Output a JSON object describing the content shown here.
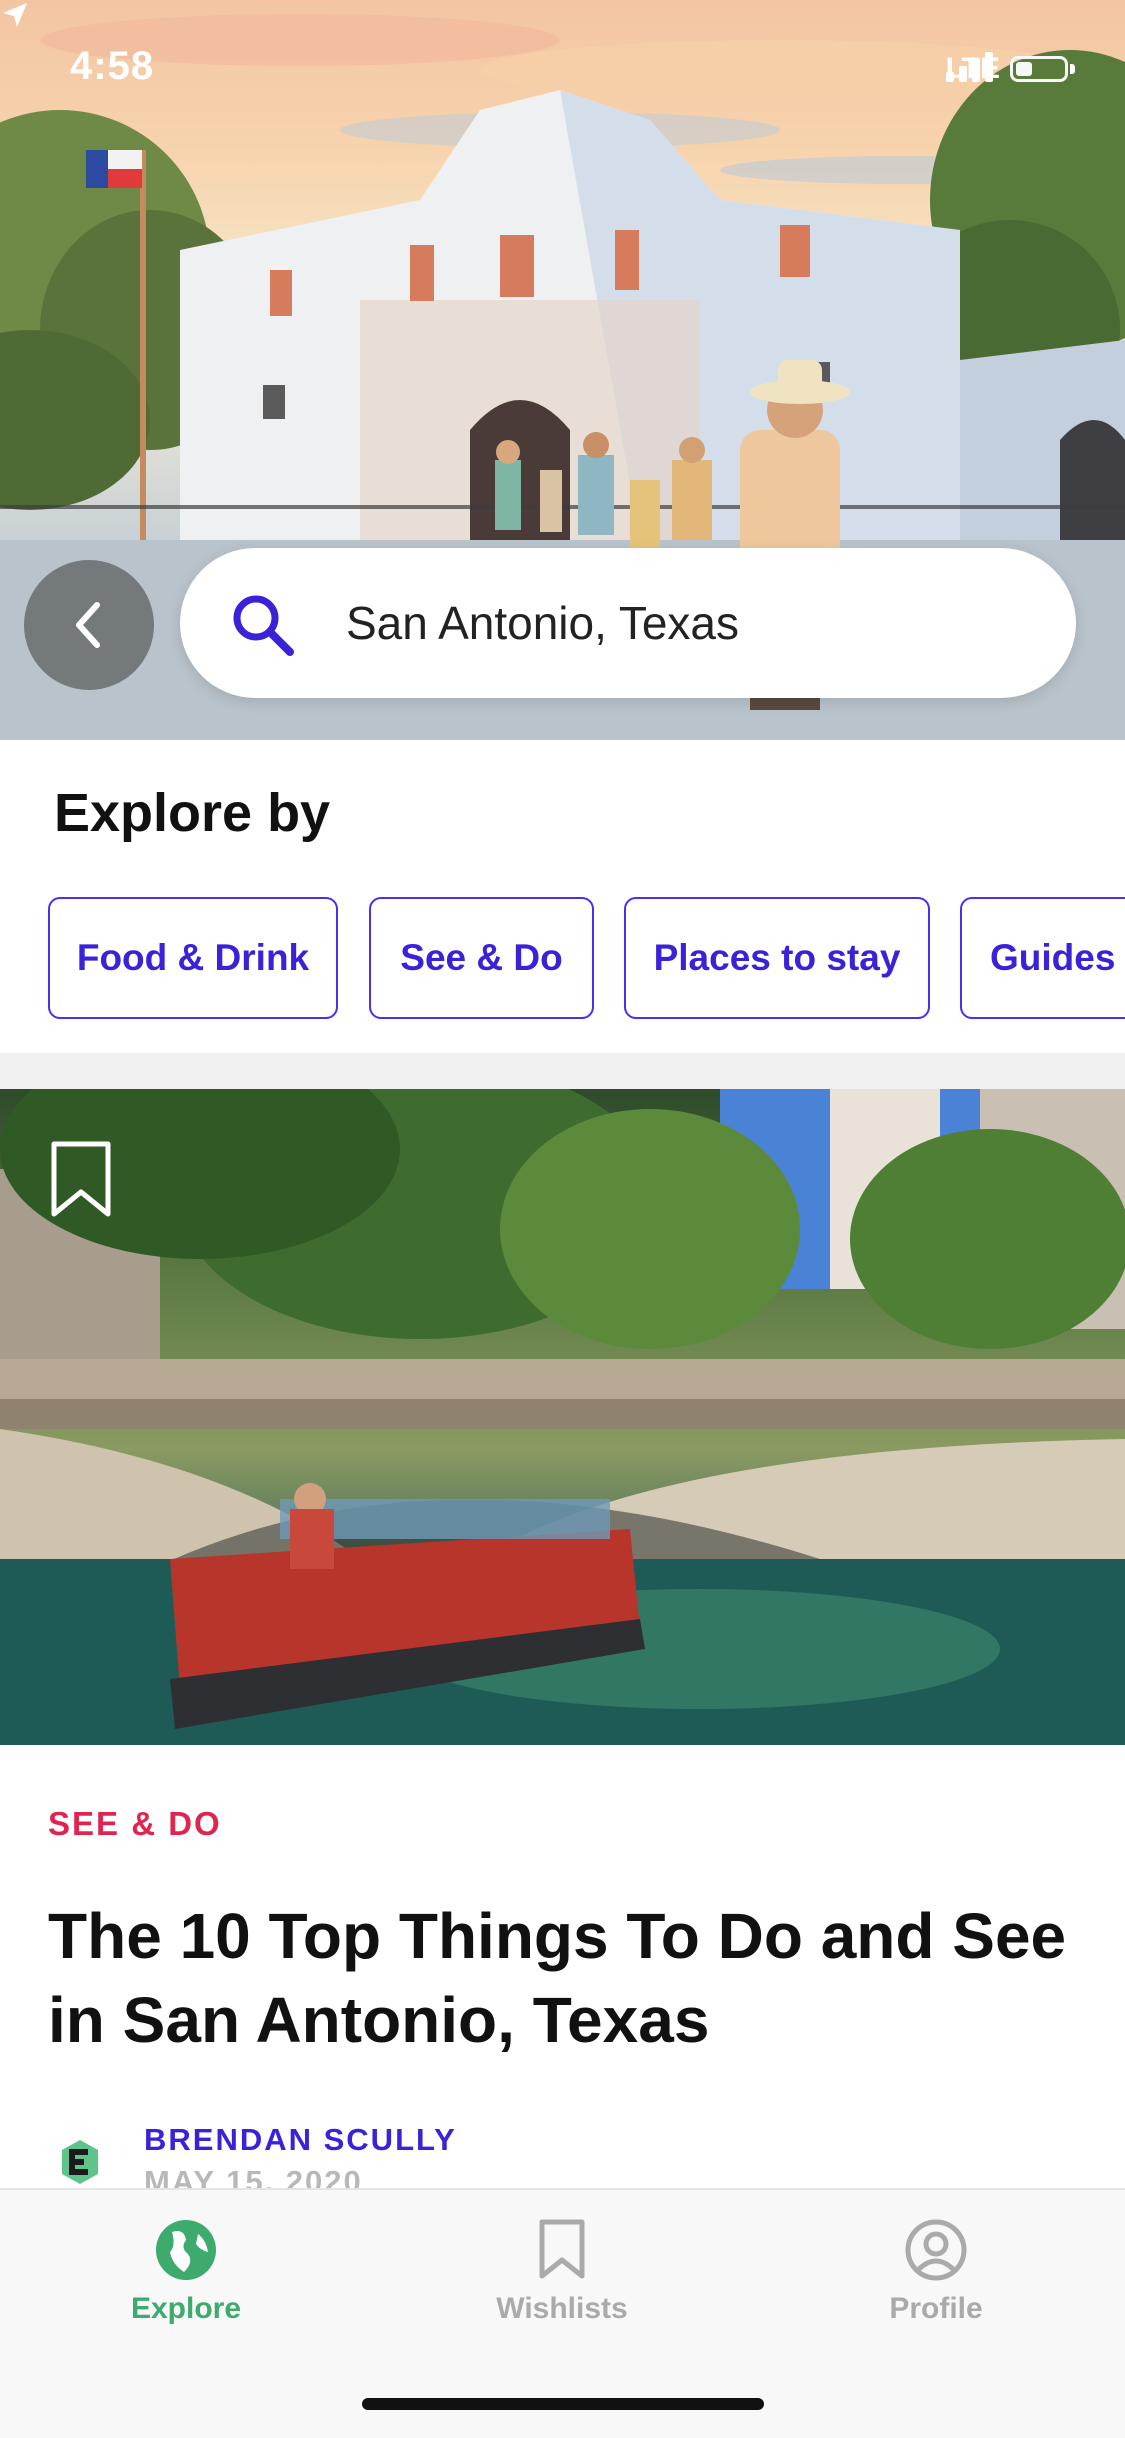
{
  "status_bar": {
    "time": "4:58",
    "carrier": "LTE"
  },
  "search": {
    "value": "San Antonio, Texas"
  },
  "explore": {
    "title": "Explore by",
    "chips": [
      {
        "label": "Food & Drink"
      },
      {
        "label": "See & Do"
      },
      {
        "label": "Places to stay"
      },
      {
        "label": "Guides & Tips"
      }
    ]
  },
  "article": {
    "category": "SEE & DO",
    "headline": "The 10 Top Things To Do and See in San Antonio, Texas",
    "author": "BRENDAN SCULLY",
    "date": "MAY 15, 2020"
  },
  "tabbar": {
    "items": [
      {
        "label": "Explore",
        "icon": "globe-icon"
      },
      {
        "label": "Wishlists",
        "icon": "bookmark-icon"
      },
      {
        "label": "Profile",
        "icon": "profile-icon"
      }
    ]
  },
  "colors": {
    "accent": "#3a22d8",
    "category": "#e0244f",
    "active_tab": "#3dab6d",
    "inactive_tab": "#aaaaaa"
  }
}
